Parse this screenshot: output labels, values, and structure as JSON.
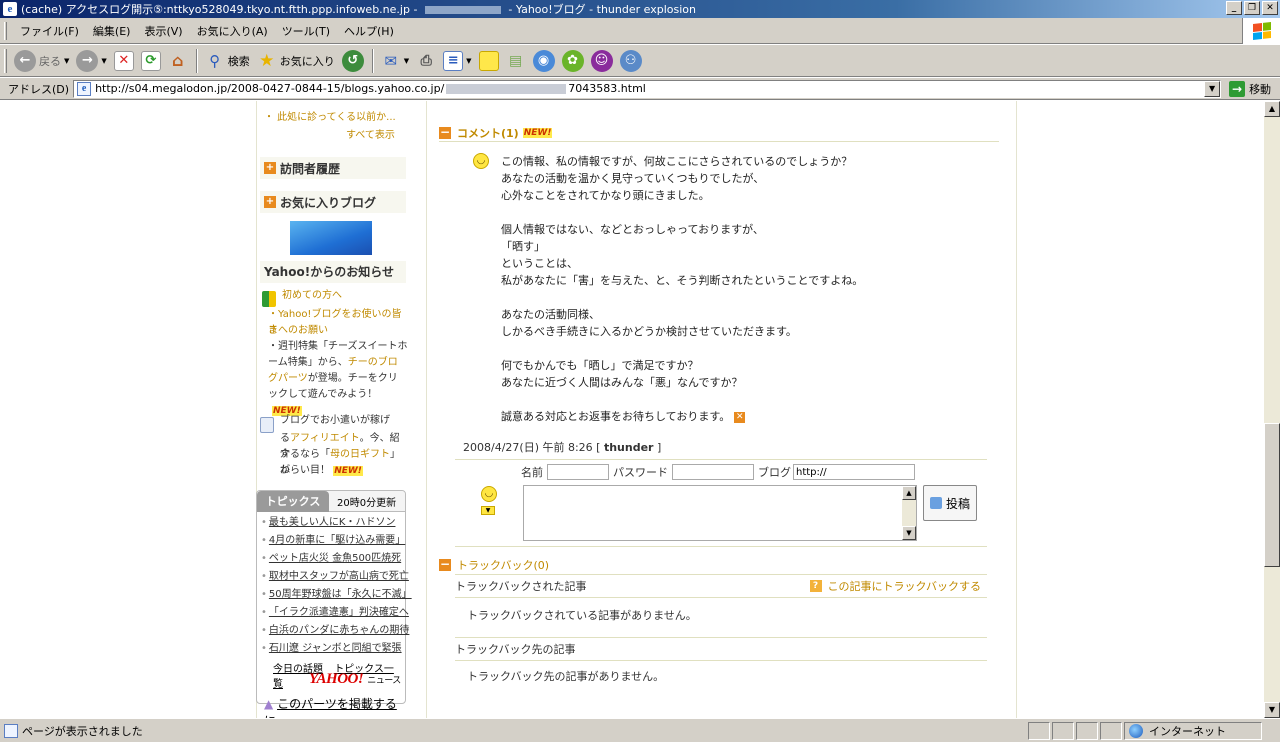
{
  "window": {
    "title_prefix": "(cache) アクセスログ開示⑤:nttkyo528049.tkyo.nt.ftth.ppp.infoweb.ne.jp -",
    "title_suffix": "- Yahoo!ブログ - thunder explosion"
  },
  "menu": [
    "ファイル(F)",
    "編集(E)",
    "表示(V)",
    "お気に入り(A)",
    "ツール(T)",
    "ヘルプ(H)"
  ],
  "toolbar": {
    "back": "戻る",
    "search": "検索",
    "favorites": "お気に入り"
  },
  "address": {
    "label": "アドレス(D)",
    "url_start": "http://s04.megalodon.jp/2008-0427-0844-15/blogs.yahoo.co.jp/",
    "url_end": "7043583.html",
    "go": "移動"
  },
  "sidebar": {
    "recent": "・ 此処に診ってくる以前か...",
    "show_all": "すべて表示",
    "visitor_history": "訪問者履歴",
    "favorite_blogs": "お気に入りブログ",
    "notice_title": "Yahoo!からのお知らせ",
    "notices": {
      "beginners": "初めての方へ",
      "request_l1": "・Yahoo!ブログをお使いの皆さ",
      "request_l2": "まへのお願い",
      "feature_l1": "・週刊特集「チーズスイートホ",
      "feature_l2": "ーム特集」から、",
      "feature_l2_link": "チーのブロ",
      "feature_l3_link": "グパーツ",
      "feature_l3": "が登場。チーをクリ",
      "feature_l4": "ックして遊んでみよう！",
      "affiliate_l1": "ブログでお小遣いが稼げ",
      "affiliate_l2_pre": "る",
      "affiliate_l2_link": "アフィリエイト",
      "affiliate_l2_post": "。今、紹介",
      "affiliate_l3_pre": "するなら「",
      "affiliate_l3_link": "母の日ギフト",
      "affiliate_l3_post": "」が",
      "affiliate_l4": "ねらい目！"
    },
    "new_badge": "NEW!",
    "topics_tab": "トピックス",
    "topics_updated": "20時0分更新",
    "topics": [
      "最も美しい人にK・ハドソン",
      "4月の新車に「駆け込み需要」",
      "ペット店火災 金魚500匹焼死",
      "取材中スタッフが高山病で死亡",
      "50周年野球盤は「永久に不滅」",
      "「イラク派遣違憲」判決確定へ",
      "白浜のパンダに赤ちゃんの期待",
      "石川遼 ジャンボと同組で緊張"
    ],
    "today_topics": "今日の話題",
    "topics_list": "トピックス一覧",
    "yahoo_logo": "YAHOO!",
    "yahoo_logo_sub": "ニュース",
    "embed_part": "このパーツを掲載するに"
  },
  "main": {
    "comment_header": "コメント(1)",
    "comment_lines": [
      "この情報、私の情報ですが、何故ここにさらされているのでしょうか？\nあなたの活動を温かく見守っていくつもりでしたが、\n心外なことをされてかなり頭にきました。",
      "個人情報ではない、などとおっしゃっておりますが、\n「晒す」\nということは、\n私があなたに「害」を与えた、と、そう判断されたということですよね。",
      "あなたの活動同様、\nしかるべき手続きに入るかどうか検討させていただきます。",
      "何でもかんでも「晒し」で満足ですか？\nあなたに近づく人間はみんな「悪」なんですか？",
      "誠意ある対応とお返事をお待ちしております。"
    ],
    "comment_meta": "2008/4/27(日) 午前 8:26 [",
    "comment_author": "thunder",
    "comment_meta_end": "]",
    "form": {
      "name_label": "名前",
      "password_label": "パスワード",
      "blog_label": "ブログ",
      "blog_value": "http://",
      "post_button": "投稿"
    },
    "trackback_header": "トラックバック(0)",
    "trackbacked_title": "トラックバックされた記事",
    "trackback_link": "この記事にトラックバックする",
    "trackbacked_empty": "トラックバックされている記事がありません。",
    "trackback_to_title": "トラックバック先の記事",
    "trackback_to_empty": "トラックバック先の記事がありません。"
  },
  "status": {
    "message": "ページが表示されました",
    "zone": "インターネット"
  },
  "colors": {
    "titlebar": "#0a246a",
    "chrome": "#d4d0c8",
    "accent_orange": "#e88a1e",
    "link_gold": "#c08a00"
  }
}
